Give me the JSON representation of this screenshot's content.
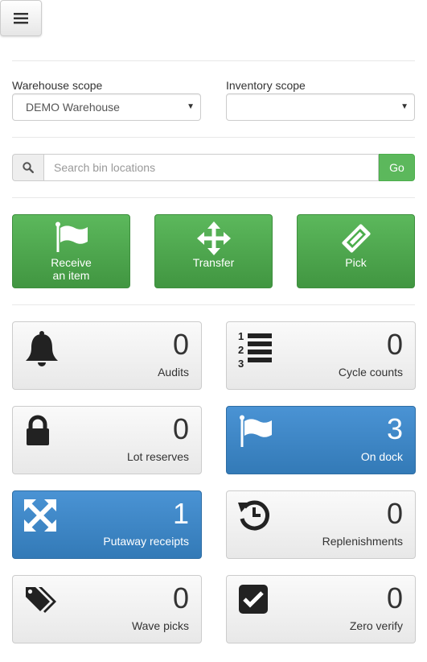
{
  "menu": {
    "icon": "hamburger-menu-icon"
  },
  "scopes": {
    "warehouse": {
      "label": "Warehouse scope",
      "value": "DEMO Warehouse"
    },
    "inventory": {
      "label": "Inventory scope",
      "value": ""
    }
  },
  "search": {
    "icon": "search-icon",
    "placeholder": "Search bin locations",
    "button": "Go"
  },
  "actions": {
    "receive": {
      "line1": "Receive",
      "line2": "an item",
      "icon": "flag-icon"
    },
    "transfer": {
      "label": "Transfer",
      "icon": "move-arrows-icon"
    },
    "pick": {
      "label": "Pick",
      "icon": "ticket-icon"
    }
  },
  "tiles": {
    "audits": {
      "count": "0",
      "label": "Audits",
      "icon": "bell-icon"
    },
    "cycle_counts": {
      "count": "0",
      "label": "Cycle counts",
      "icon": "numbered-list-icon"
    },
    "lot_reserves": {
      "count": "0",
      "label": "Lot reserves",
      "icon": "lock-icon"
    },
    "on_dock": {
      "count": "3",
      "label": "On dock",
      "icon": "flag-icon"
    },
    "putaway_receipts": {
      "count": "1",
      "label": "Putaway receipts",
      "icon": "expand-arrows-icon"
    },
    "replenishments": {
      "count": "0",
      "label": "Replenishments",
      "icon": "history-icon"
    },
    "wave_picks": {
      "count": "0",
      "label": "Wave picks",
      "icon": "tags-icon"
    },
    "zero_verify": {
      "count": "0",
      "label": "Zero verify",
      "icon": "check-square-icon"
    }
  },
  "colors": {
    "green": "#5cb85c",
    "blue": "#337ab7",
    "tile_gray": "#eeeeee"
  }
}
